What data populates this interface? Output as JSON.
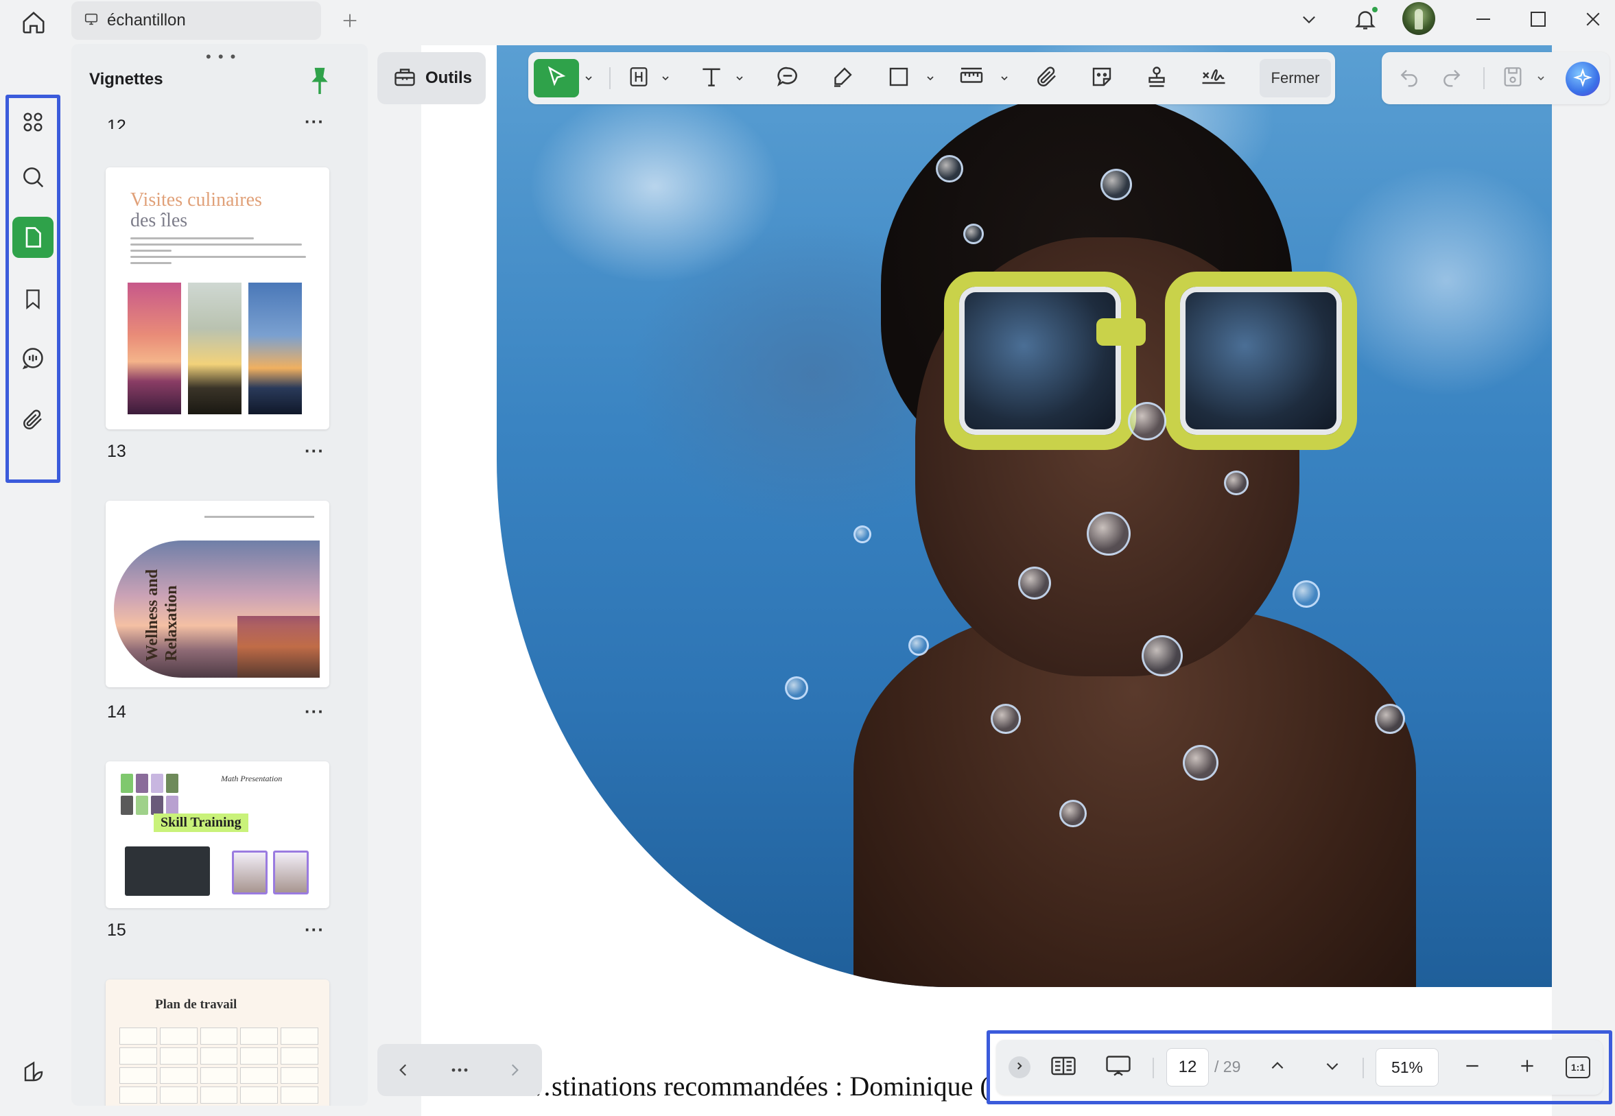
{
  "window": {
    "tab_title": "échantillon",
    "controls": [
      "minimize",
      "maximize",
      "close"
    ]
  },
  "sidebar": {
    "items": [
      {
        "id": "apps",
        "icon": "grid-icon",
        "active": false
      },
      {
        "id": "search",
        "icon": "search-icon",
        "active": false
      },
      {
        "id": "thumbnails",
        "icon": "page-icon",
        "active": true
      },
      {
        "id": "bookmarks",
        "icon": "bookmark-icon",
        "active": false
      },
      {
        "id": "comments",
        "icon": "comment-icon",
        "active": false
      },
      {
        "id": "attachments",
        "icon": "paperclip-icon",
        "active": false
      }
    ],
    "bottom_icon": "layers-icon"
  },
  "thumbnail_panel": {
    "title": "Vignettes",
    "partial_label": "12",
    "thumbnails": [
      {
        "number": "13",
        "title_line1": "Visites culinaires",
        "title_line2": "des îles"
      },
      {
        "number": "14",
        "title": "Wellness and Relaxation"
      },
      {
        "number": "15",
        "heading": "Math Presentation",
        "title": "Skill Training"
      },
      {
        "number": "",
        "title": "Plan de travail"
      }
    ],
    "more_label": "···"
  },
  "tools": {
    "label": "Outils"
  },
  "toolbar": {
    "close_label": "Fermer",
    "accent": "#2fa24a"
  },
  "document": {
    "caption": "stinations recommandées : Dominique (",
    "caption_prefix": "…"
  },
  "status_bar": {
    "current_page": "12",
    "total_pages": "/ 29",
    "zoom": "51%",
    "ratio_label": "1:1"
  },
  "colors": {
    "accent": "#2fa24a",
    "highlight_box": "#3b5bdb"
  }
}
